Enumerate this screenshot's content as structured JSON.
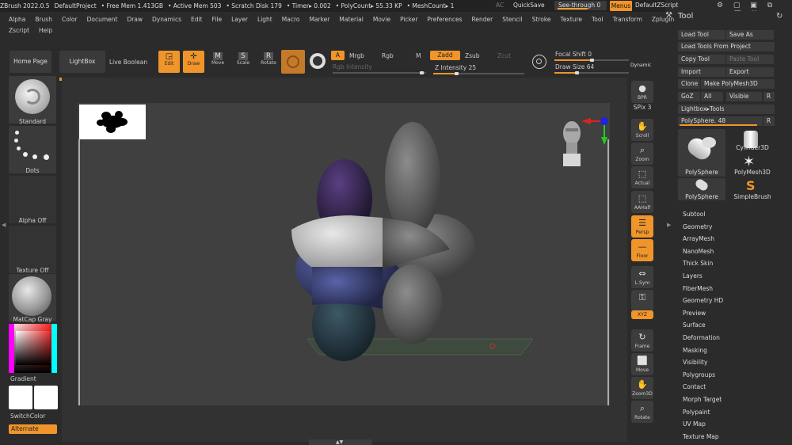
{
  "titlebar": {
    "items": [
      "ZBrush 2022.0.5",
      "DefaultProject",
      "• Free Mem 1.413GB",
      "• Active Mem 503",
      "• Scratch Disk 179",
      "• Timer▸ 0.002",
      "• PolyCount▸ 55.33 KP",
      "• MeshCount▸ 1"
    ],
    "ac": "AC",
    "quicksave": "QuickSave",
    "seethrough": "See-through  0",
    "menus": "Menus",
    "defaultzscript": "DefaultZScript",
    "icons": "⚙ ▢ ▣ ⧉ — □ ✕"
  },
  "menubar": [
    "Alpha",
    "Brush",
    "Color",
    "Document",
    "Draw",
    "Dynamics",
    "Edit",
    "File",
    "Layer",
    "Light",
    "Macro",
    "Marker",
    "Material",
    "Movie",
    "Picker",
    "Preferences",
    "Render",
    "Stencil",
    "Stroke",
    "Texture",
    "Tool",
    "Transform",
    "Zplugin"
  ],
  "menubar2": [
    "Zscript",
    "Help"
  ],
  "toolbar": {
    "home_page": "Home Page",
    "lightbox": "LightBox",
    "live_boolean": "Live Boolean",
    "edit": "Edit",
    "draw": "Draw",
    "move": "Move",
    "scale": "Scale",
    "rotate": "Rotate",
    "a": "A",
    "mrgb": "Mrgb",
    "rgb": "Rgb",
    "m": "M",
    "zadd": "Zadd",
    "zsub": "Zsub",
    "zcut": "Zcut",
    "rgb_intensity": "Rgb Intensity",
    "z_intensity_label": "Z Intensity",
    "z_intensity_value": "25",
    "focal_shift_label": "Focal Shift",
    "focal_shift_value": "0",
    "draw_size_label": "Draw Size",
    "draw_size_value": "64",
    "dynamic": "Dynamic",
    "z_intensity_pct": 25,
    "focal_shift_pct": 50,
    "draw_size_pct": 30
  },
  "leftpanel": {
    "standard": "Standard",
    "dots": "Dots",
    "alpha_off": "Alpha Off",
    "texture_off": "Texture Off",
    "matcap": "MatCap Gray",
    "gradient": "Gradient",
    "switchcolor": "SwitchColor",
    "alternate": "Alternate"
  },
  "rightbar": [
    {
      "name": "bpr-button",
      "label": "BPR"
    },
    {
      "name": "spix-slider",
      "label": "SPix 3"
    },
    {
      "name": "scroll-button",
      "label": "Scroll"
    },
    {
      "name": "zoom-button",
      "label": "Zoom"
    },
    {
      "name": "actual-button",
      "label": "Actual"
    },
    {
      "name": "aahalf-button",
      "label": "AAHalf"
    },
    {
      "name": "persp-button",
      "label": "Persp"
    },
    {
      "name": "floor-button",
      "label": "Floor"
    },
    {
      "name": "lsym-button",
      "label": "L.Sym"
    },
    {
      "name": "lock-button",
      "label": ""
    },
    {
      "name": "xyz-button",
      "label": "XYZ"
    },
    {
      "name": "frame-button",
      "label": "Frame"
    },
    {
      "name": "move-view-button",
      "label": "Move"
    },
    {
      "name": "zoom3d-button",
      "label": "Zoom3D"
    },
    {
      "name": "rotate-view-button",
      "label": "Rotate"
    }
  ],
  "toolpanel": {
    "title": "Tool",
    "load_tool": "Load Tool",
    "save_as": "Save As",
    "load_from_project": "Load Tools From Project",
    "copy_tool": "Copy Tool",
    "paste_tool": "Paste Tool",
    "import": "Import",
    "export": "Export",
    "clone": "Clone",
    "make_polymesh": "Make PolyMesh3D",
    "goz": "GoZ",
    "all": "All",
    "visible": "Visible",
    "r": "R",
    "lightbox_tools": "Lightbox▸Tools",
    "polysphere_label": "PolySphere.",
    "polysphere_value": "48",
    "polysphere_pct": 95,
    "thumbs": [
      "PolySphere",
      "Cylinder3D",
      "PolyMesh3D",
      "PolySphere",
      "SimpleBrush"
    ],
    "subpalettes": [
      "Subtool",
      "Geometry",
      "ArrayMesh",
      "NanoMesh",
      "Thick Skin",
      "Layers",
      "FiberMesh",
      "Geometry HD",
      "Preview",
      "Surface",
      "Deformation",
      "Masking",
      "Visibility",
      "Polygroups",
      "Contact",
      "Morph Target",
      "Polypaint",
      "UV Map",
      "Texture Map"
    ]
  },
  "colors": {
    "accent": "#f0952a",
    "viewport": "#404040",
    "panel": "#2b2b2b"
  }
}
